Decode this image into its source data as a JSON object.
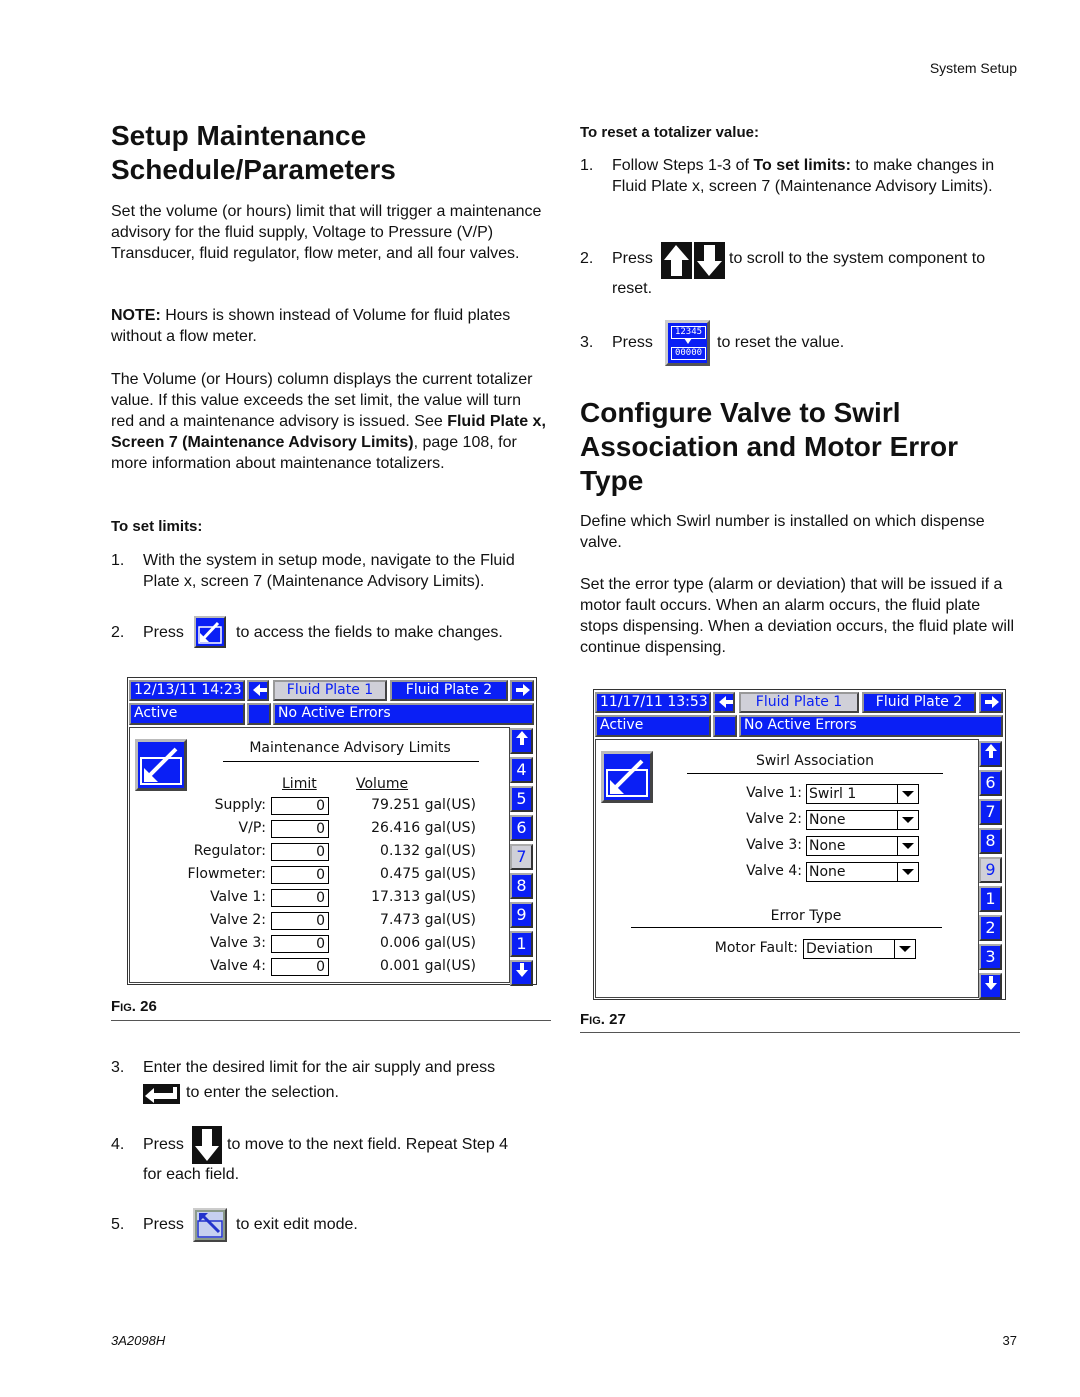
{
  "header": {
    "section": "System Setup"
  },
  "left": {
    "title_line1": "Setup Maintenance",
    "title_line2": "Schedule/Parameters",
    "para1": "Set the volume (or hours) limit that will trigger a maintenance advisory for the fluid supply, Voltage to Pressure (V/P) Transducer, fluid regulator, flow meter, and all four valves.",
    "note_label": "NOTE:",
    "note_text": " Hours is shown instead of Volume for fluid plates without a flow meter.",
    "para3_a": "The Volume (or Hours) column displays the current totalizer value. If this value exceeds the set limit, the value will turn red and a maintenance advisory is issued. See ",
    "para3_bold": "Fluid Plate x, Screen 7 (Maintenance Advisory Limits)",
    "para3_b": ", page 108, for more information about maintenance totalizers.",
    "set_limits_heading": "To set limits:",
    "steps": [
      {
        "num": "1.",
        "text": "With the system in setup mode, navigate to the Fluid Plate x, screen 7 (Maintenance Advisory Limits)."
      },
      {
        "num": "2.",
        "pre": "Press",
        "post": "to access the fields to make changes.",
        "icon": "edit-mode-icon"
      },
      {
        "num": "3.",
        "text": "Enter the desired limit for the air supply and press",
        "post": "to enter the selection.",
        "icon": "enter-icon"
      },
      {
        "num": "4.",
        "pre": "Press",
        "post": "to move to the next field. Repeat Step 4",
        "post2": "for each field.",
        "icon": "down-arrow-icon"
      },
      {
        "num": "5.",
        "pre": "Press",
        "post": "to exit edit mode.",
        "icon": "exit-edit-icon"
      }
    ],
    "fig_label": "FIG. 26",
    "fig_prefix": "F",
    "fig_small": "IG",
    "fig_num": ". 26"
  },
  "fig26": {
    "datetime": "12/13/11 14:23",
    "tab1": "Fluid Plate 1",
    "tab2": "Fluid Plate 2",
    "status": "Active",
    "errors": "No Active Errors",
    "screen_title": "Maintenance Advisory Limits",
    "col_limit": "Limit",
    "col_volume": "Volume",
    "rows": [
      {
        "label": "Supply:",
        "limit": "0",
        "volume": "79.251 gal(US)"
      },
      {
        "label": "V/P:",
        "limit": "0",
        "volume": "26.416 gal(US)"
      },
      {
        "label": "Regulator:",
        "limit": "0",
        "volume": "0.132 gal(US)"
      },
      {
        "label": "Flowmeter:",
        "limit": "0",
        "volume": "0.475 gal(US)"
      },
      {
        "label": "Valve 1:",
        "limit": "0",
        "volume": "17.313 gal(US)"
      },
      {
        "label": "Valve 2:",
        "limit": "0",
        "volume": "7.473 gal(US)"
      },
      {
        "label": "Valve 3:",
        "limit": "0",
        "volume": "0.006 gal(US)"
      },
      {
        "label": "Valve 4:",
        "limit": "0",
        "volume": "0.001 gal(US)"
      }
    ],
    "nav": [
      "4",
      "5",
      "6",
      "7",
      "8",
      "9",
      "1"
    ],
    "nav_selected": "7"
  },
  "right": {
    "reset_heading": "To reset a totalizer value:",
    "reset_steps": [
      {
        "num": "1.",
        "a": "Follow Steps 1-3 of ",
        "bold": "To set limits:",
        "b": " to make changes in Fluid Plate x, screen 7 (Maintenance Advisory Limits)."
      },
      {
        "num": "2.",
        "pre": "Press",
        "post": "to scroll to the system component to",
        "post2": "reset."
      },
      {
        "num": "3.",
        "pre": "Press",
        "post": "to reset the value."
      }
    ],
    "reset_icon_top": "12345",
    "reset_icon_bottom": "00000",
    "title_line1": "Configure Valve to Swirl",
    "title_line2": "Association and Motor Error",
    "title_line3": "Type",
    "para1": "Define which Swirl number is installed on which dispense valve.",
    "para2": "Set the error type (alarm or deviation) that will be issued if a motor fault occurs. When an alarm occurs, the fluid plate stops dispensing. When a deviation occurs, the fluid plate will continue dispensing.",
    "fig_prefix": "F",
    "fig_small": "IG",
    "fig_num": ". 27"
  },
  "fig27": {
    "datetime": "11/17/11 13:53",
    "tab1": "Fluid Plate 1",
    "tab2": "Fluid Plate 2",
    "status": "Active",
    "errors": "No Active Errors",
    "section1": "Swirl Association",
    "valves": [
      {
        "label": "Valve 1:",
        "value": "Swirl 1"
      },
      {
        "label": "Valve 2:",
        "value": "None"
      },
      {
        "label": "Valve 3:",
        "value": "None"
      },
      {
        "label": "Valve 4:",
        "value": "None"
      }
    ],
    "section2": "Error Type",
    "motor_label": "Motor Fault:",
    "motor_value": "Deviation",
    "nav": [
      "6",
      "7",
      "8",
      "9",
      "1",
      "2",
      "3"
    ],
    "nav_selected": "9"
  },
  "footer": {
    "doc_id": "3A2098H",
    "page": "37"
  },
  "colors": {
    "screen_blue": "#0a1ff5",
    "selected_gray": "#d0d0d8"
  }
}
